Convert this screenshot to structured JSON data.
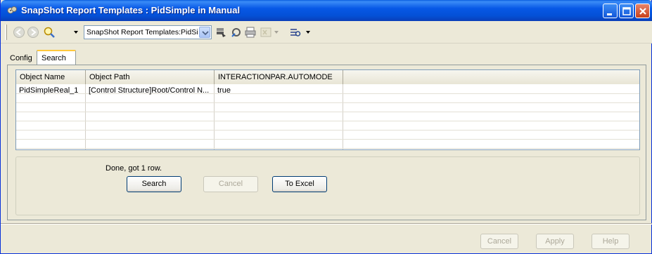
{
  "window": {
    "title": "SnapShot Report Templates : PidSimple in Manual"
  },
  "toolbar": {
    "back_icon": "back-arrow-icon",
    "forward_icon": "forward-arrow-icon",
    "search_icon": "magnifier-icon",
    "combo_value": "SnapShot Report Templates:PidSimpl",
    "icons": [
      "report-stack-icon",
      "properties-icon",
      "print-icon",
      "excel-icon",
      "view-icon"
    ]
  },
  "tabs": [
    {
      "label": "Config"
    },
    {
      "label": "Search"
    }
  ],
  "grid": {
    "columns": [
      "Object Name",
      "Object Path",
      "INTERACTIONPAR.AUTOMODE"
    ],
    "rows": [
      [
        "PidSimpleReal_1",
        "[Control Structure]Root/Control N...",
        "true"
      ]
    ]
  },
  "status": {
    "text": "Done, got 1 row."
  },
  "actions": {
    "search": "Search",
    "cancel": "Cancel",
    "to_excel": "To Excel"
  },
  "footer": {
    "cancel": "Cancel",
    "apply": "Apply",
    "help": "Help"
  },
  "colors": {
    "titlebar": "#0450d6",
    "tab_highlight": "#ffc83c",
    "close_button": "#c8401a"
  }
}
